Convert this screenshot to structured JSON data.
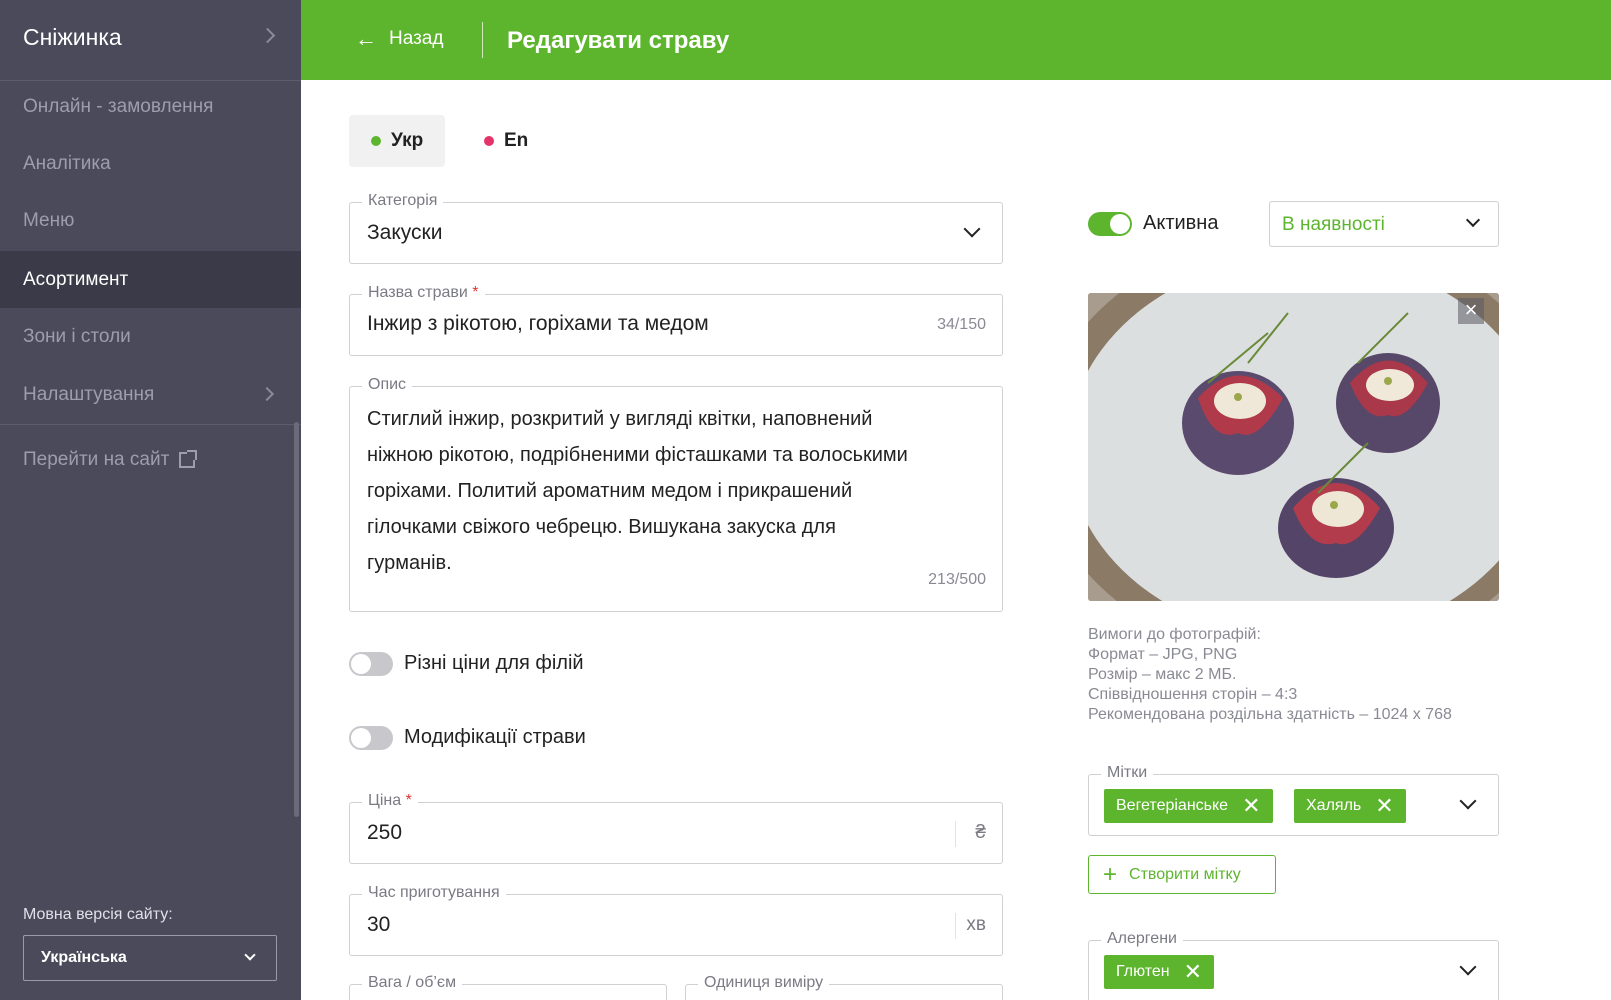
{
  "sidebar": {
    "brand": "Сніжинка",
    "items": [
      {
        "label": "Онлайн - замовлення"
      },
      {
        "label": "Аналітика"
      },
      {
        "label": "Меню"
      },
      {
        "label": "Асортимент",
        "active": true
      },
      {
        "label": "Зони і столи"
      },
      {
        "label": "Налаштування"
      }
    ],
    "site_link": "Перейти на сайт",
    "lang_label": "Мовна версія сайту:",
    "lang_value": "Українська"
  },
  "header": {
    "back_label": "Назад",
    "title": "Редагувати страву",
    "color": "#5db52e"
  },
  "lang_tabs": [
    {
      "label": "Укр",
      "dot_color": "#5db52e",
      "active": true
    },
    {
      "label": "En",
      "dot_color": "#e5336a",
      "active": false
    }
  ],
  "form": {
    "category": {
      "label": "Категорія",
      "value": "Закуски"
    },
    "name": {
      "label": "Назва страви",
      "required_mark": "*",
      "value": "Інжир з рікотою, горіхами та медом",
      "counter": "34/150"
    },
    "description": {
      "label": "Опис",
      "lines": [
        "Стиглий інжир, розкритий у вигляді квітки, наповнений",
        "ніжною рікотою, подрібненими фісташками та волоськими",
        "горіхами. Политий ароматним медом і прикрашений",
        "гілочками свіжого чебрецю. Вишукана закуска для",
        "гурманів."
      ],
      "counter": "213/500"
    },
    "branch_prices_toggle": {
      "label": "Різні ціни для філій",
      "on": false
    },
    "modifications_toggle": {
      "label": "Модифікації страви",
      "on": false
    },
    "price": {
      "label": "Ціна",
      "required_mark": "*",
      "value": "250",
      "suffix": "₴"
    },
    "cook_time": {
      "label": "Час приготування",
      "value": "30",
      "suffix": "хв"
    },
    "weight": {
      "label": "Вага / об’єм"
    },
    "unit": {
      "label": "Одиниця виміру"
    }
  },
  "right": {
    "active_toggle": {
      "label": "Активна",
      "on": true
    },
    "availability": {
      "value": "В наявності"
    },
    "photo_close": "×",
    "photo_requirements": [
      "Вимоги до фотографій:",
      "Формат – JPG, PNG",
      "Розмір – макс 2 МБ.",
      "Співвідношення сторін – 4:3",
      "Рекомендована роздільна здатність – 1024 х 768"
    ],
    "tags": {
      "label": "Мітки",
      "chips": [
        "Вегетеріанське",
        "Халяль"
      ]
    },
    "create_tag_label": "Створити мітку",
    "allergens": {
      "label": "Алергени",
      "chips": [
        "Глютен"
      ]
    }
  }
}
